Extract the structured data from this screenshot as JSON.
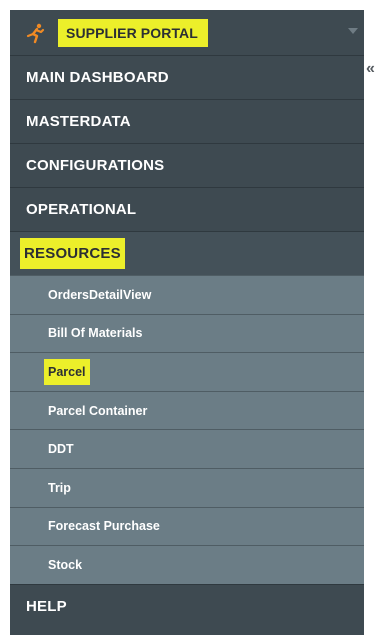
{
  "header": {
    "brand": "SUPPLIER PORTAL",
    "logo_icon": "running-figure-icon",
    "caret_icon": "caret-down-icon",
    "highlight_color": "#ecef2a"
  },
  "collapse_icon": "double-chevron-left-icon",
  "menu": {
    "main_dashboard": "MAIN DASHBOARD",
    "masterdata": "MASTERDATA",
    "configurations": "CONFIGURATIONS",
    "operational": "OPERATIONAL",
    "resources": "RESOURCES",
    "help": "HELP"
  },
  "resources_items": [
    "OrdersDetailView",
    "Bill Of Materials",
    "Parcel",
    "Parcel Container",
    "DDT",
    "Trip",
    "Forecast Purchase",
    "Stock"
  ],
  "colors": {
    "sidebar_bg": "#3e4a51",
    "submenu_bg": "#6b7d86",
    "logo": "#f08a24"
  }
}
